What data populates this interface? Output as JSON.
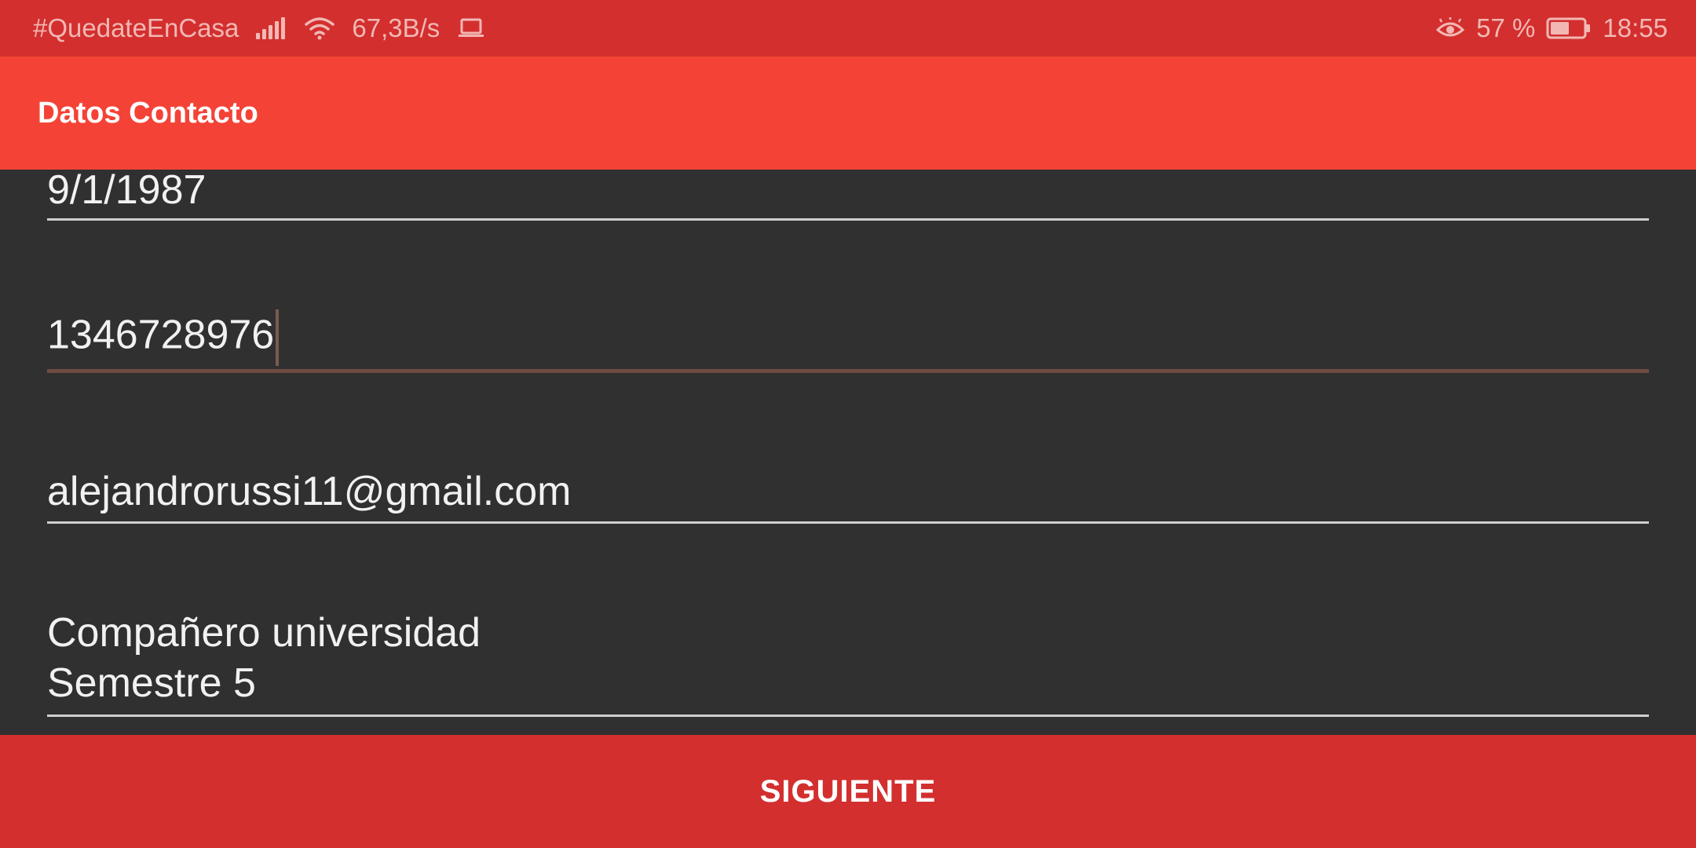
{
  "status_bar": {
    "hashtag": "#QuedateEnCasa",
    "network_speed": "67,3B/s",
    "battery_percent": "57 %",
    "time": "18:55",
    "icons": [
      "signal-icon",
      "wifi-icon",
      "laptop-icon",
      "eye-icon",
      "battery-icon"
    ],
    "battery_level": 0.57
  },
  "app_bar": {
    "title": "Datos Contacto"
  },
  "form": {
    "fields": [
      {
        "value": "9/1/1987"
      },
      {
        "value": "1346728976",
        "focused": true
      },
      {
        "value": "alejandrorussi11@gmail.com"
      },
      {
        "value": "Compañero universidad\nSemestre 5"
      }
    ]
  },
  "footer": {
    "next_label": "SIGUIENTE"
  },
  "colors": {
    "status_bar": "#d32f2f",
    "app_bar": "#f44336",
    "background": "#303030",
    "focused_underline": "#6d4c41",
    "button": "#d32f2f"
  }
}
